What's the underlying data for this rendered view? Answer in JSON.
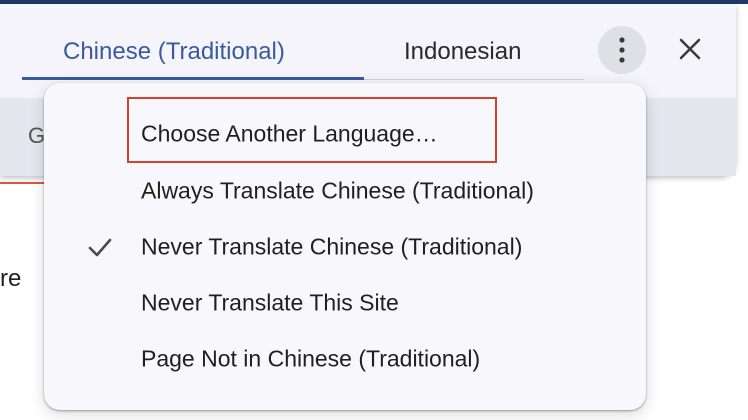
{
  "tabs": [
    {
      "label": "Chinese (Traditional)",
      "selected": true
    },
    {
      "label": "Indonesian",
      "selected": false
    }
  ],
  "content_stub": {
    "letter": "G"
  },
  "background_text": "re",
  "toolbar": {
    "more_icon": "vertical-ellipsis",
    "close_icon": "close-x"
  },
  "menu": {
    "items": [
      {
        "label": "Choose Another Language…",
        "checked": false,
        "highlighted": true
      },
      {
        "label": "Always Translate Chinese (Traditional)",
        "checked": false
      },
      {
        "label": "Never Translate Chinese (Traditional)",
        "checked": true
      },
      {
        "label": "Never Translate This Site",
        "checked": false
      },
      {
        "label": "Page Not in Chinese (Traditional)",
        "checked": false
      }
    ]
  },
  "colors": {
    "accent": "#3a5aa0",
    "highlight_box": "#d2422e",
    "topbar": "#1f3a66"
  }
}
